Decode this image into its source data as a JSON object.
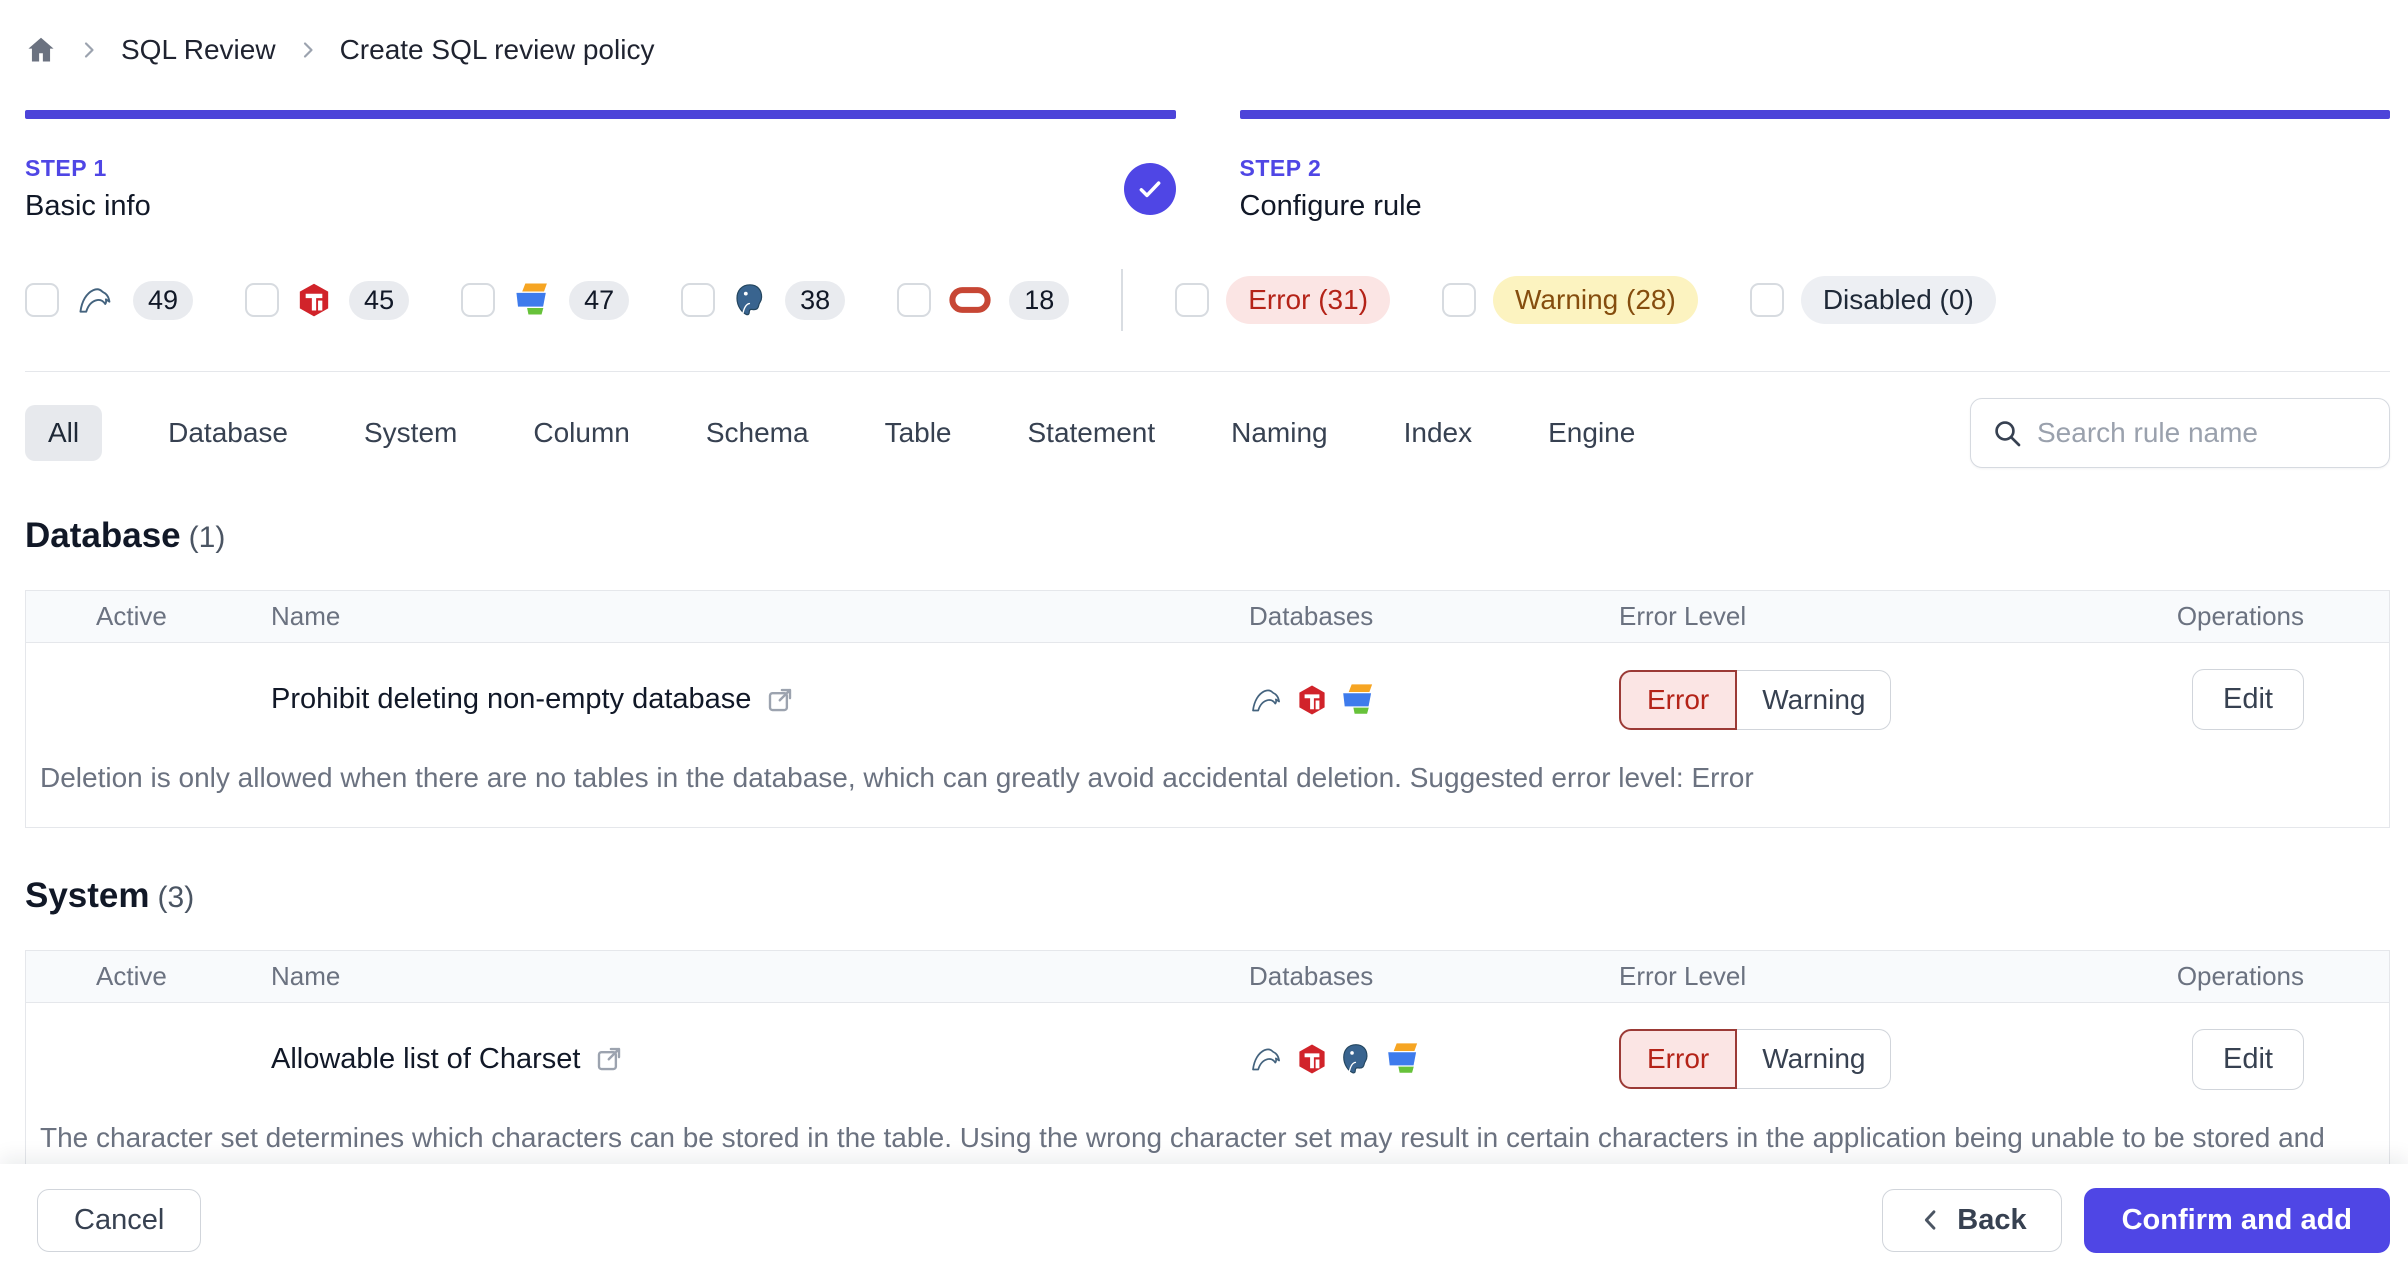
{
  "colors": {
    "accent": "#4f46e5",
    "error_text": "#b42318",
    "error_bg": "#fbe5e4",
    "warning_text": "#854d0e",
    "warning_bg": "#fcf3c0",
    "disabled_bg": "#edeff3"
  },
  "breadcrumb": {
    "items": [
      "SQL Review",
      "Create SQL review policy"
    ]
  },
  "steps": [
    {
      "label": "STEP 1",
      "title": "Basic info",
      "completed": true
    },
    {
      "label": "STEP 2",
      "title": "Configure rule",
      "completed": false
    }
  ],
  "engine_filters": [
    {
      "engine": "mysql",
      "count": "49"
    },
    {
      "engine": "tidb",
      "count": "45"
    },
    {
      "engine": "oceanbase",
      "count": "47"
    },
    {
      "engine": "postgresql",
      "count": "38"
    },
    {
      "engine": "oracle",
      "count": "18"
    }
  ],
  "level_filters": [
    {
      "label": "Error (31)",
      "type": "error"
    },
    {
      "label": "Warning (28)",
      "type": "warning"
    },
    {
      "label": "Disabled (0)",
      "type": "disabled"
    }
  ],
  "tabs": [
    "All",
    "Database",
    "System",
    "Column",
    "Schema",
    "Table",
    "Statement",
    "Naming",
    "Index",
    "Engine"
  ],
  "active_tab": "All",
  "search": {
    "placeholder": "Search rule name"
  },
  "table_columns": [
    "Active",
    "Name",
    "Databases",
    "Error Level",
    "Operations"
  ],
  "sections": [
    {
      "title": "Database",
      "count": "(1)",
      "rules": [
        {
          "name": "Prohibit deleting non-empty database",
          "active": true,
          "engines": [
            "mysql",
            "tidb",
            "oceanbase"
          ],
          "selected_level": "Error",
          "levels": {
            "error": "Error",
            "warning": "Warning"
          },
          "operation": "Edit",
          "description": "Deletion is only allowed when there are no tables in the database, which can greatly avoid accidental deletion. Suggested error level: Error"
        }
      ]
    },
    {
      "title": "System",
      "count": "(3)",
      "rules": [
        {
          "name": "Allowable list of Charset",
          "active": true,
          "engines": [
            "mysql",
            "tidb",
            "postgresql",
            "oceanbase"
          ],
          "selected_level": "Error",
          "levels": {
            "error": "Error",
            "warning": "Warning"
          },
          "operation": "Edit",
          "description": "The character set determines which characters can be stored in the table. Using the wrong character set may result in certain characters in the application being unable to be stored and displayed correctly, such as CJK and Emoji. Suggested error level: Error"
        }
      ]
    }
  ],
  "footer": {
    "cancel": "Cancel",
    "back": "Back",
    "confirm": "Confirm and add"
  }
}
